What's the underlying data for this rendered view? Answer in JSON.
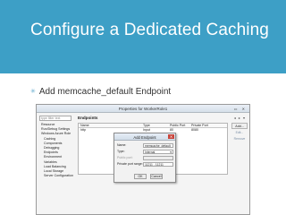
{
  "slide": {
    "title": "Configure a Dedicated Caching",
    "bullet": "Add memcache_default Endpoint",
    "bullet_marker": "✳"
  },
  "colors": {
    "title_band": "#3d9fc6",
    "bullet_marker": "#6aaed0"
  },
  "window": {
    "title": "Properties for WorkerRole1",
    "filter_placeholder": "type filter text",
    "tree": [
      {
        "label": "Resource",
        "level": 1
      },
      {
        "label": "Run/Debug Settings",
        "level": 1
      },
      {
        "label": "Windows Azure Role",
        "level": 1
      },
      {
        "label": "Caching",
        "level": 2
      },
      {
        "label": "Components",
        "level": 2
      },
      {
        "label": "Debugging",
        "level": 2
      },
      {
        "label": "Endpoints",
        "level": 2
      },
      {
        "label": "Environment Variables",
        "level": 2
      },
      {
        "label": "Load Balancing",
        "level": 2
      },
      {
        "label": "Local Storage",
        "level": 2
      },
      {
        "label": "Server Configuration",
        "level": 2
      }
    ],
    "section_title": "Endpoints",
    "table": {
      "headers": [
        "Name",
        "Type",
        "Public Port",
        "Private Port"
      ],
      "rows": [
        [
          "http",
          "Input",
          "80",
          "8080"
        ]
      ]
    },
    "buttons": {
      "add": "Add...",
      "edit": "Edit...",
      "remove": "Remove"
    }
  },
  "dialog": {
    "title": "Add Endpoint",
    "fields": [
      {
        "label": "Name:",
        "value": "memcache_default"
      },
      {
        "label": "Type:",
        "value": "Internal"
      },
      {
        "label": "Public port:",
        "value": ""
      },
      {
        "label": "Private port range:",
        "value": "11211  -  11211"
      }
    ],
    "ok": "OK",
    "cancel": "Cancel"
  }
}
